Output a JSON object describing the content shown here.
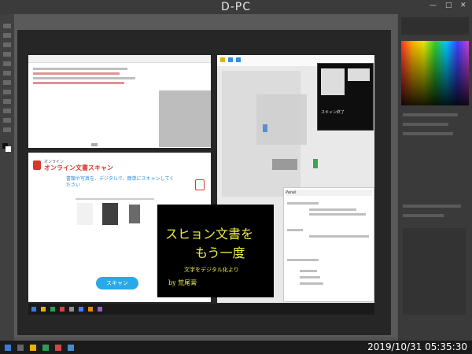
{
  "window": {
    "title": "D-PC",
    "controls": [
      "—",
      "□",
      "✕"
    ]
  },
  "scan_app": {
    "brand_small": "オンライン",
    "brand": "オンライン文書スキャン",
    "tagline": "書類や写真を、デジタルで、簡単にスキャンしてください",
    "scan_button": "スキャン"
  },
  "poster": {
    "line1": "スヒョン文書を",
    "line2": "もう一度",
    "sub": "文字をデジタル化より",
    "by": "by 荒尾膏"
  },
  "right_window": {
    "title": "Panel",
    "preview_caption": "スキャン終了"
  },
  "clock": {
    "text": "2019/10/31 05:35:30"
  },
  "colors": {
    "accent": "#29a9e8",
    "poster_text": "#f0ee46",
    "app_red": "#d33a2c"
  }
}
